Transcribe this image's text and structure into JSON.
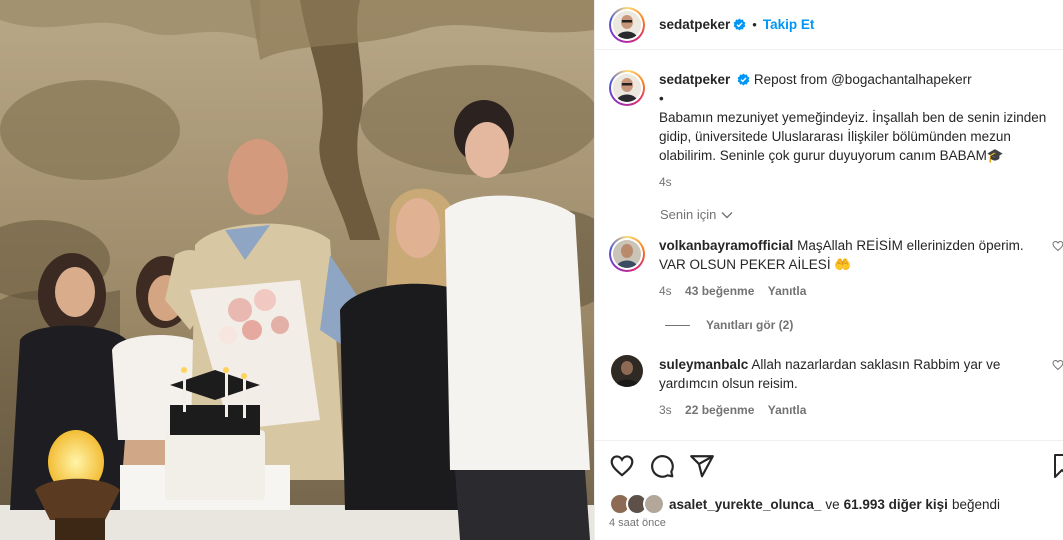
{
  "post": {
    "author": "sedatpeker",
    "dot": "•",
    "follow_label": "Takip Et"
  },
  "caption": {
    "author": "sedatpeker",
    "repost_text": "Repost from @bogachantalhapekerr",
    "bullet": "•",
    "lines": [
      "Babamın mezuniyet yemeğindeyiz. İnşallah ben de senin izinden",
      "gidip, üniversitede Uluslararası İlişkiler bölümünden mezun",
      "olabilirim. Seninle çok gurur duyuyorum canım BABAM🎓"
    ],
    "age": "4s"
  },
  "sorting": {
    "label": "Senin için"
  },
  "comments": [
    {
      "author": "volkanbayramofficial",
      "text_line1": "MaşAllah REİSİM ellerinizden öperim.",
      "text_line2": "VAR OLSUN PEKER AİLESİ 🤲",
      "age": "4s",
      "likes": "43 beğenme",
      "reply": "Yanıtla",
      "view_replies": "Yanıtları gör (2)"
    },
    {
      "author": "suleymanbalc",
      "text_line1": "Allah nazarlardan saklasın Rabbim yar ve",
      "text_line2": "yardımcın olsun reisim.",
      "age": "3s",
      "likes": "22 beğenme",
      "reply": "Yanıtla"
    }
  ],
  "likes": {
    "user": "asalet_yurekte_olunca_",
    "connector": "ve",
    "others": "61.993 diğer kişi",
    "suffix": "beğendi"
  },
  "timestamp": "4 saat önce",
  "icons": {
    "like": "heart-icon",
    "comment": "comment-icon",
    "share": "share-icon",
    "save": "bookmark-icon",
    "verified": "verified-badge-icon",
    "sorting": "chevron-down-icon"
  },
  "colors": {
    "link": "#0095f6",
    "verified": "#0095f6",
    "secondary_text": "#737373",
    "divider": "#efefef"
  }
}
